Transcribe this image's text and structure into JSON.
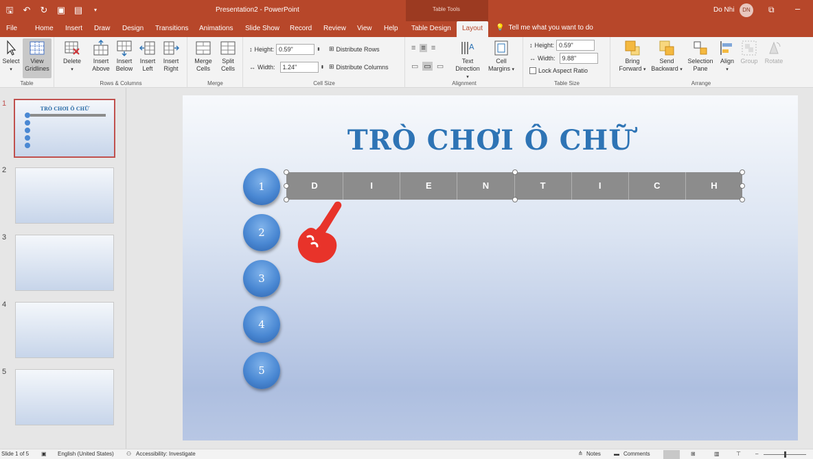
{
  "window": {
    "title": "Presentation2  -  PowerPoint",
    "context_label": "Table Tools",
    "user_name": "Do Nhi",
    "user_initials": "DN"
  },
  "tabs": [
    "File",
    "Home",
    "Insert",
    "Draw",
    "Design",
    "Transitions",
    "Animations",
    "Slide Show",
    "Record",
    "Review",
    "View",
    "Help",
    "Table Design",
    "Layout"
  ],
  "active_tab": "Layout",
  "tell_me": "Tell me what you want to do",
  "ribbon": {
    "table": {
      "label": "Table",
      "select": "Select",
      "view_gridlines_1": "View",
      "view_gridlines_2": "Gridlines"
    },
    "rows_columns": {
      "label": "Rows & Columns",
      "delete": "Delete",
      "insert_above_1": "Insert",
      "insert_above_2": "Above",
      "insert_below_1": "Insert",
      "insert_below_2": "Below",
      "insert_left_1": "Insert",
      "insert_left_2": "Left",
      "insert_right_1": "Insert",
      "insert_right_2": "Right"
    },
    "merge": {
      "label": "Merge",
      "merge_1": "Merge",
      "merge_2": "Cells",
      "split_1": "Split",
      "split_2": "Cells"
    },
    "cell_size": {
      "label": "Cell Size",
      "height_label": "Height:",
      "height_value": "0.59\"",
      "width_label": "Width:",
      "width_value": "1.24\"",
      "distribute_rows": "Distribute Rows",
      "distribute_columns": "Distribute Columns"
    },
    "alignment": {
      "label": "Alignment",
      "text_dir_1": "Text",
      "text_dir_2": "Direction",
      "margins_1": "Cell",
      "margins_2": "Margins"
    },
    "table_size": {
      "label": "Table Size",
      "height_label": "Height:",
      "height_value": "0.59\"",
      "width_label": "Width:",
      "width_value": "9.88\"",
      "lock_aspect": "Lock Aspect Ratio"
    },
    "arrange": {
      "label": "Arrange",
      "bring_1": "Bring",
      "bring_2": "Forward",
      "send_1": "Send",
      "send_2": "Backward",
      "sel_pane_1": "Selection",
      "sel_pane_2": "Pane",
      "align": "Align",
      "group": "Group",
      "rotate": "Rotate"
    }
  },
  "thumbnails": [
    "1",
    "2",
    "3",
    "4",
    "5"
  ],
  "thumb_title": "TRÒ CHƠI Ô CHỮ",
  "slide": {
    "title": "TRÒ CHƠI Ô CHỮ",
    "numbers": [
      "1",
      "2",
      "3",
      "4",
      "5"
    ],
    "letters": [
      "D",
      "I",
      "E",
      "N",
      "T",
      "I",
      "C",
      "H"
    ]
  },
  "status": {
    "slide_of": "Slide 1 of 5",
    "language": "English (United States)",
    "accessibility": "Accessibility: Investigate",
    "notes": "Notes",
    "comments": "Comments"
  },
  "colors": {
    "accent": "#b7472a",
    "title_blue": "#2e74b5",
    "cell_gray": "#8c8c8c",
    "pointer_red": "#e8332a"
  }
}
